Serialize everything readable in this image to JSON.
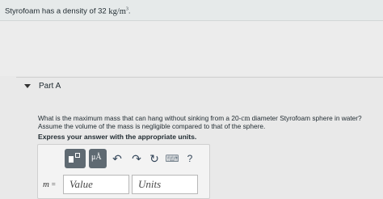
{
  "intro": {
    "text_prefix": "Styrofoam has a density of 32 ",
    "unit_html": "kg/m",
    "exponent": "3",
    "suffix": "."
  },
  "part": {
    "title": "Part A"
  },
  "question": {
    "text_before_unit": "What is the maximum mass that can hang without sinking from a 20-",
    "unit": "cm",
    "text_after_unit": " diameter Styrofoam sphere in water? Assume the volume of the mass is negligible compared to that of the sphere."
  },
  "instruction": "Express your answer with the appropriate units.",
  "toolbar": {
    "symbol_label": "μÅ",
    "undo_icon": "↶",
    "redo_icon": "↷",
    "reset_icon": "↻",
    "keyboard_icon": "⌨",
    "help_icon": "?"
  },
  "answer": {
    "variable": "m",
    "equals": "=",
    "value_placeholder": "Value",
    "units_placeholder": "Units"
  }
}
